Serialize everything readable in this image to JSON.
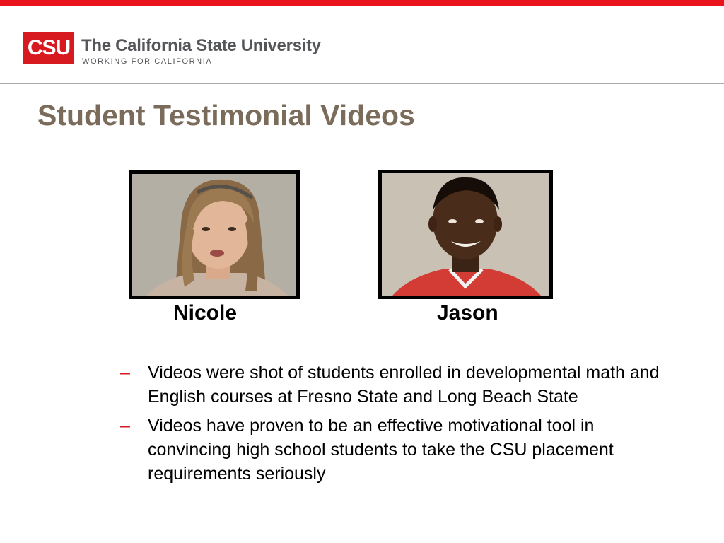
{
  "header": {
    "logo_mark": "CSU",
    "logo_name": "The California State University",
    "logo_tagline": "WORKING FOR CALIFORNIA",
    "accent_color": "#e8131b"
  },
  "slide": {
    "title": "Student Testimonial Videos",
    "title_color": "#7a6b5b",
    "videos": [
      {
        "name": "Nicole"
      },
      {
        "name": "Jason"
      }
    ],
    "bullets": [
      {
        "marker": "–",
        "text": "Videos were shot of students enrolled in developmental math and English courses at Fresno State and Long Beach State"
      },
      {
        "marker": "–",
        "text": "Videos have proven to be an effective motivational tool in convincing high school students to take the CSU placement requirements seriously"
      }
    ]
  }
}
